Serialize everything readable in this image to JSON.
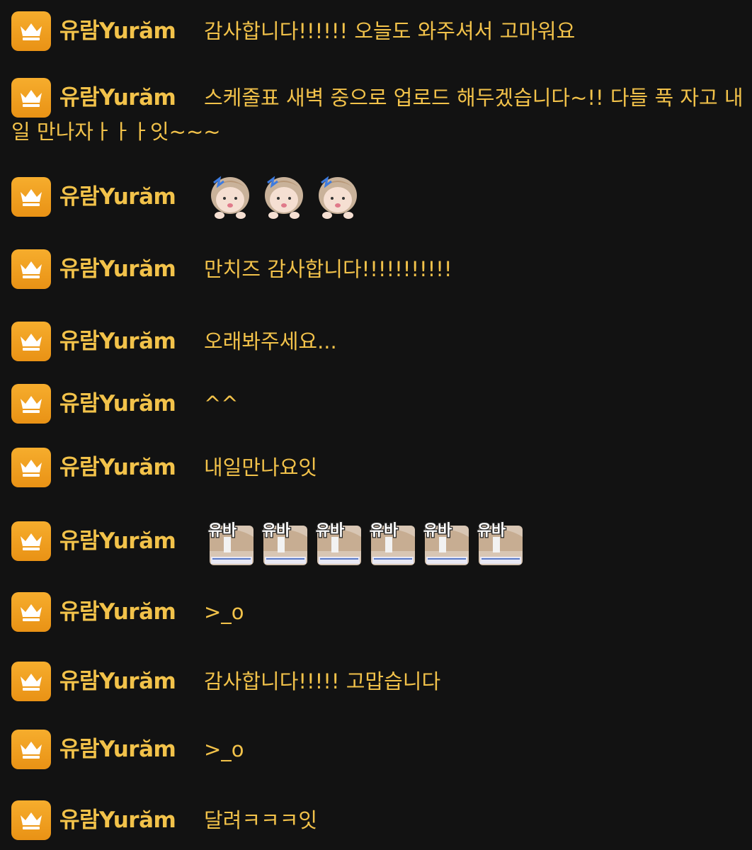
{
  "user": {
    "name": "유람Yurăm",
    "badge_icon": "crown-icon",
    "badge_color": "#f29e1f",
    "text_color": "#f2c24a"
  },
  "messages": [
    {
      "type": "text",
      "text": "감사합니다!!!!!! 오늘도 와주셔서 고마워요"
    },
    {
      "type": "text",
      "text": "스케줄표 새벽 중으로 업로드 해두겠습니다~!! 다들 푹 자고 내일 만나자ㅏㅏㅏ잇~~~"
    },
    {
      "type": "emote",
      "emote": "chibi-face-emote",
      "count": 3
    },
    {
      "type": "text",
      "text": "만치즈 감사합니다!!!!!!!!!!!"
    },
    {
      "type": "text",
      "text": "오래봐주세요..."
    },
    {
      "type": "text",
      "text": "^^"
    },
    {
      "type": "text",
      "text": "내일만나요잇"
    },
    {
      "type": "emote",
      "emote": "yuba-emote",
      "label": "유바",
      "count": 6
    },
    {
      "type": "text",
      "text": ">_o"
    },
    {
      "type": "text",
      "text": "감사합니다!!!!! 고맙습니다"
    },
    {
      "type": "text",
      "text": ">_o"
    },
    {
      "type": "text",
      "text": "달려ㅋㅋㅋ잇"
    }
  ]
}
